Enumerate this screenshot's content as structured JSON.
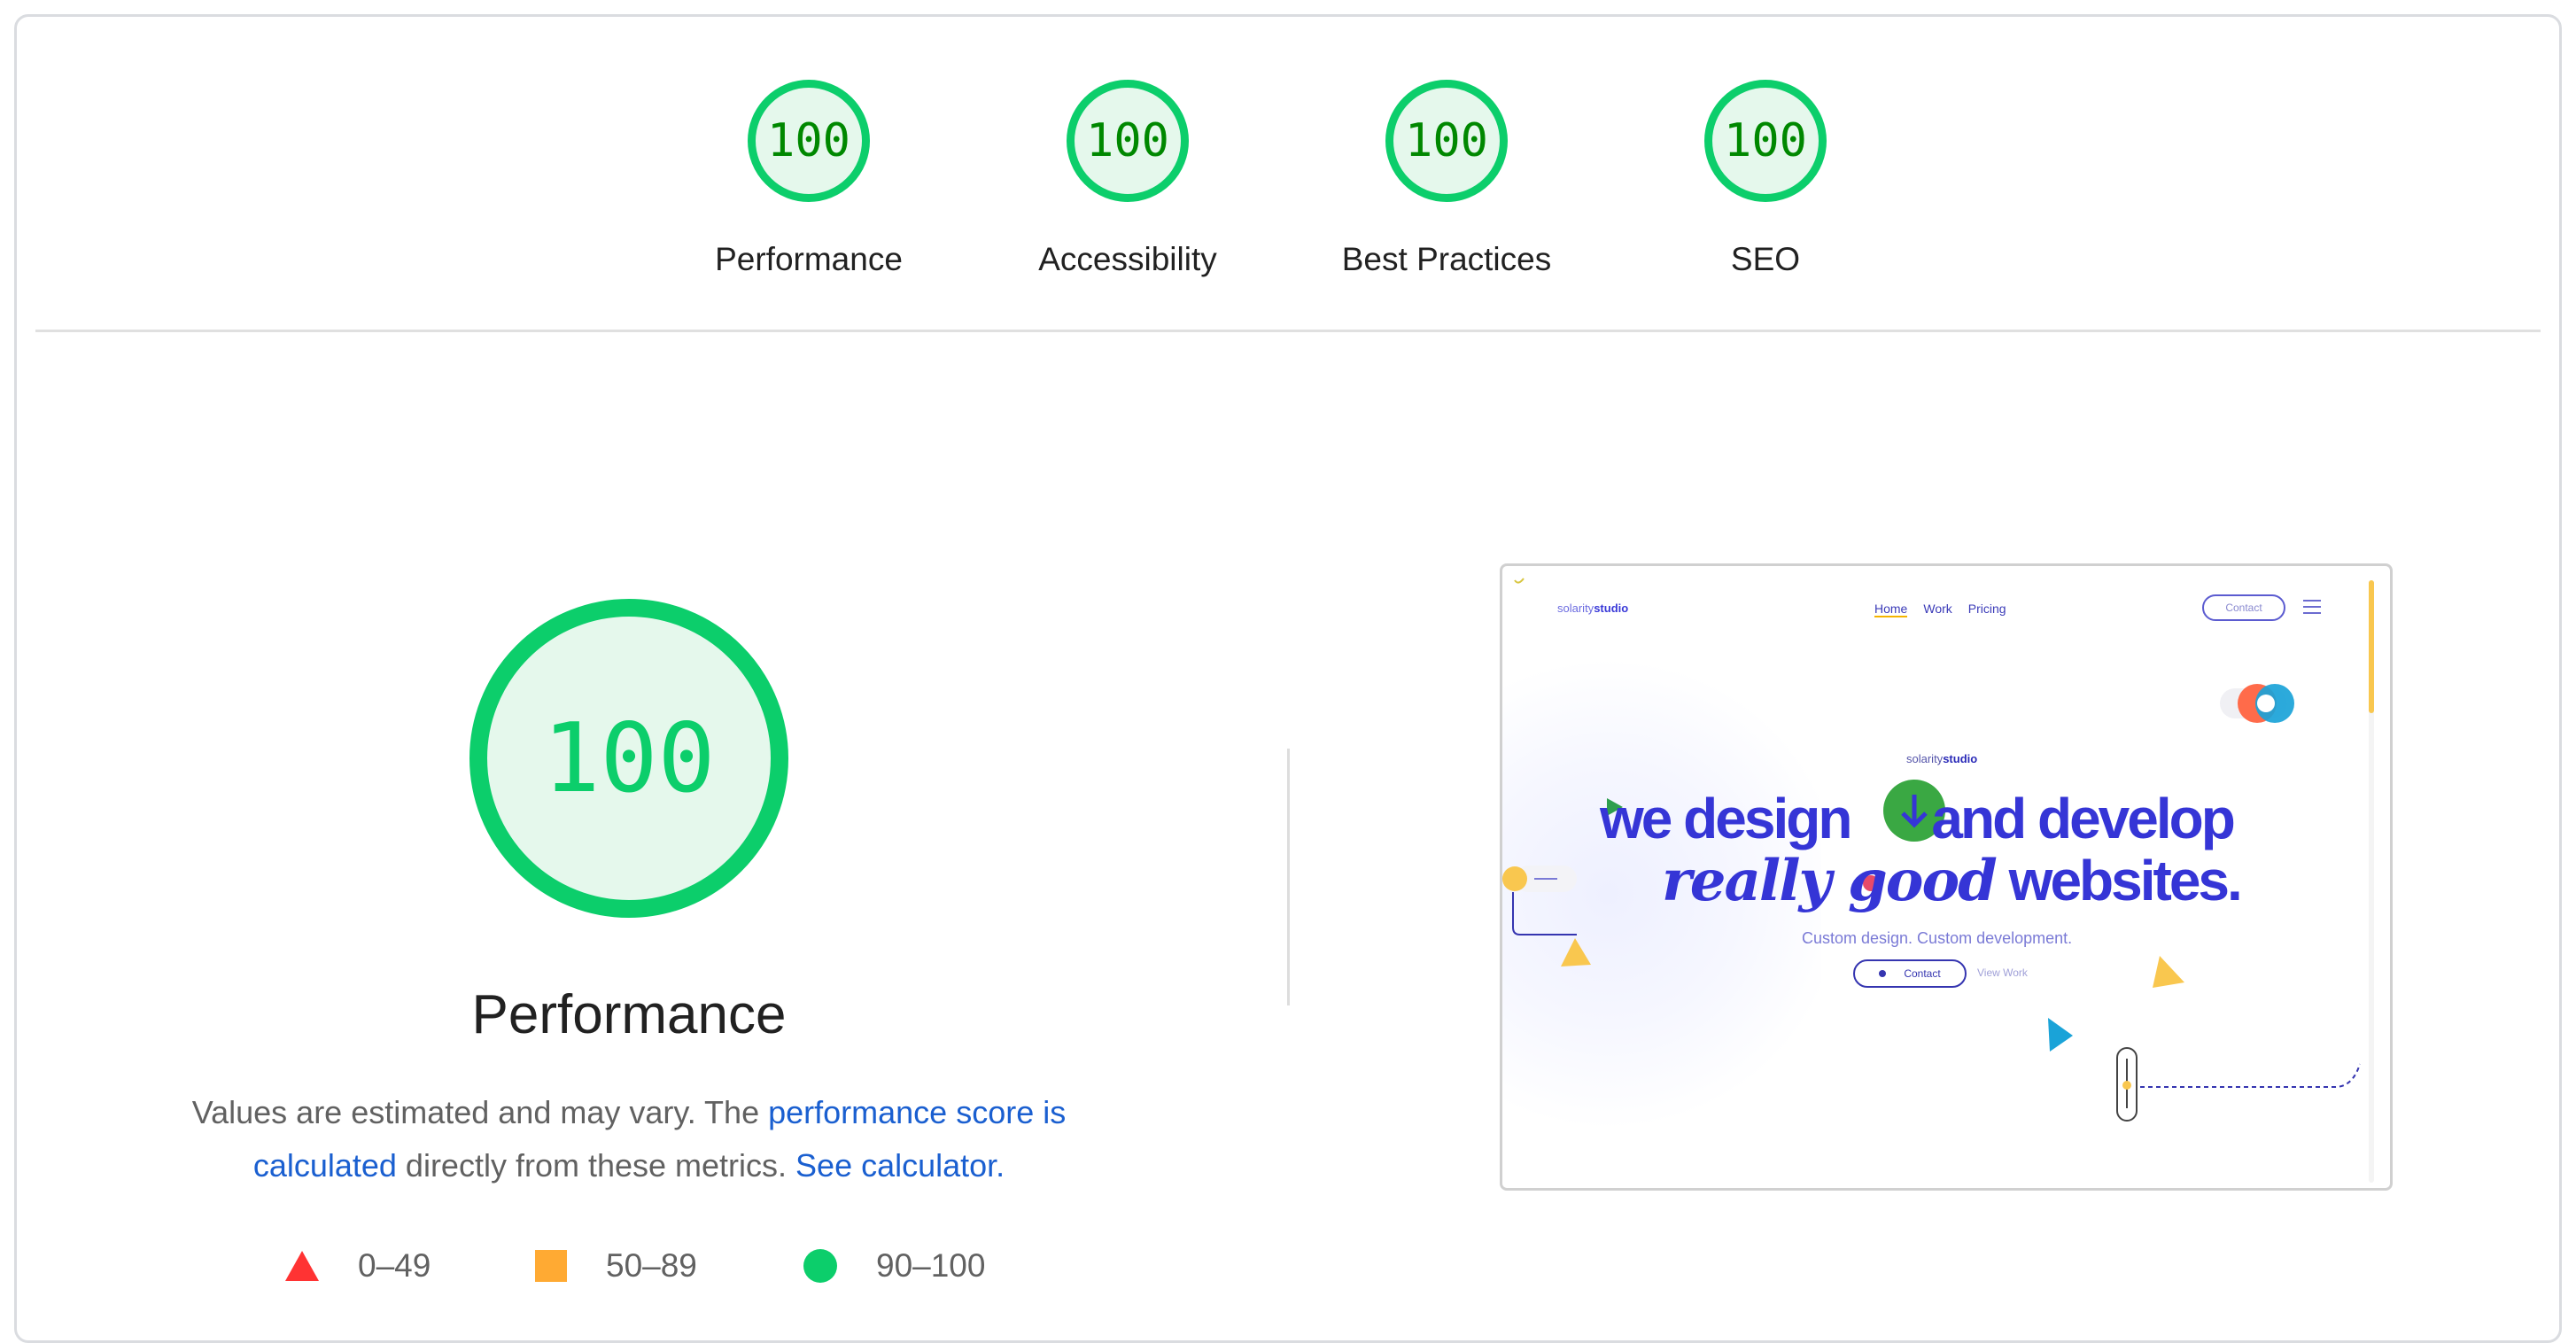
{
  "categories": [
    {
      "label": "Performance",
      "score": "100"
    },
    {
      "label": "Accessibility",
      "score": "100"
    },
    {
      "label": "Best Practices",
      "score": "100"
    },
    {
      "label": "SEO",
      "score": "100"
    }
  ],
  "main": {
    "score": "100",
    "title": "Performance",
    "desc_prefix": "Values are estimated and may vary. The ",
    "desc_link1": "performance score is calculated",
    "desc_middle": " directly from these metrics. ",
    "desc_link2": "See calculator."
  },
  "legend": {
    "fail": "0–49",
    "average": "50–89",
    "pass": "90–100"
  },
  "colors": {
    "pass": "#0cce6b",
    "average": "#ffaa33",
    "fail": "#ff3333",
    "link": "#1a5fd0"
  },
  "screenshot": {
    "logo_light": "solarity",
    "logo_bold": "studio",
    "nav": [
      "Home",
      "Work",
      "Pricing"
    ],
    "contact_top": "Contact",
    "line1_a": "we design",
    "line1_b": "and develop",
    "line2_a": "really good",
    "line2_b": "websites.",
    "tagline": "Custom design. Custom development.",
    "contact_button": "Contact",
    "view_work": "View Work"
  }
}
